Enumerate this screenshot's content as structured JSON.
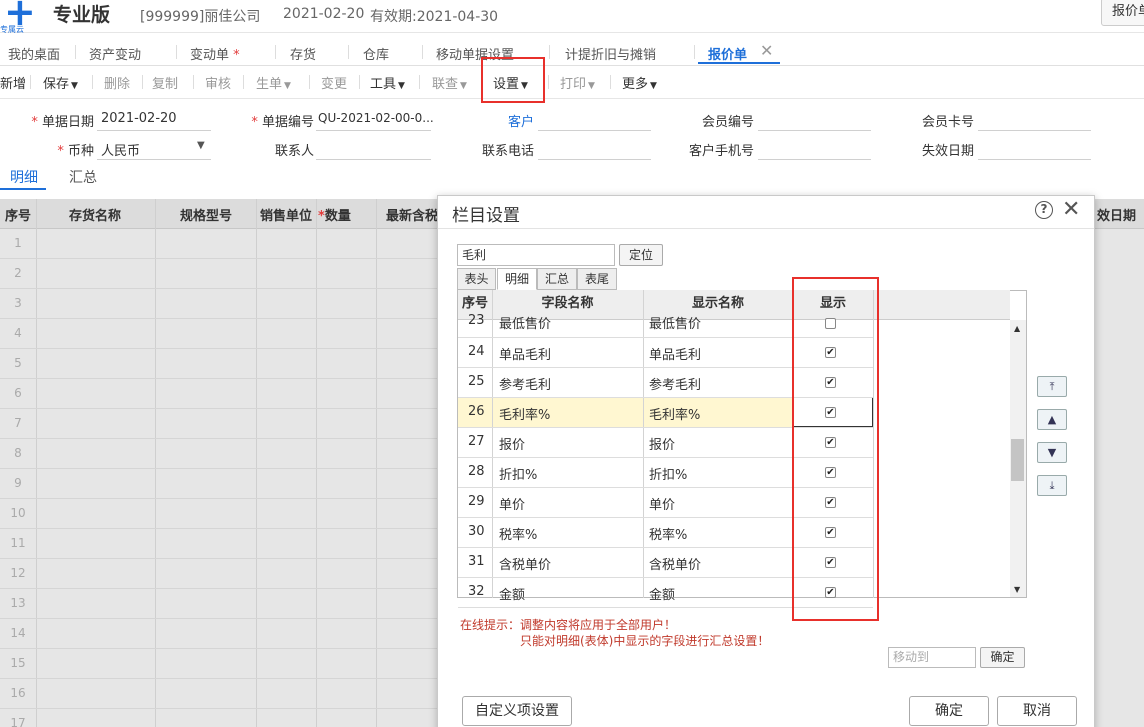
{
  "header": {
    "logo_sub": "专属云",
    "edition": "专业版",
    "company": "[999999]丽佳公司",
    "date": "2021-02-20",
    "validity": "有效期:2021-04-30",
    "quote_button": "报价单"
  },
  "nav_tabs": [
    {
      "label": "我的桌面"
    },
    {
      "label": "资产变动"
    },
    {
      "label": "变动单",
      "modified": "*"
    },
    {
      "label": "存货"
    },
    {
      "label": "仓库"
    },
    {
      "label": "移动单据设置"
    },
    {
      "label": "计提折旧与摊销"
    },
    {
      "label": "报价单",
      "active": true
    }
  ],
  "toolbar": {
    "new": "新增",
    "save": "保存",
    "delete": "删除",
    "copy": "复制",
    "audit": "审核",
    "generate": "生单",
    "change": "变更",
    "tools": "工具",
    "query": "联查",
    "settings": "设置",
    "print": "打印",
    "more": "更多"
  },
  "form": {
    "doc_date_label": "单据日期",
    "doc_date_value": "2021-02-20",
    "doc_no_label": "单据编号",
    "doc_no_value": "QU-2021-02-00-0...",
    "customer_label": "客户",
    "member_no_label": "会员编号",
    "member_card_label": "会员卡号",
    "currency_label": "币种",
    "currency_value": "人民币",
    "contact_label": "联系人",
    "phone_label": "联系电话",
    "mobile_label": "客户手机号",
    "expire_label": "失效日期"
  },
  "sub_tabs": {
    "detail": "明细",
    "summary": "汇总"
  },
  "grid": {
    "headers": [
      "序号",
      "存货名称",
      "规格型号",
      "销售单位",
      "数量",
      "最新含税",
      "效日期"
    ],
    "quantity_required": "*",
    "row_numbers": [
      "1",
      "2",
      "3",
      "4",
      "5",
      "6",
      "7",
      "8",
      "9",
      "10",
      "11",
      "12",
      "13",
      "14",
      "15",
      "16",
      "17"
    ]
  },
  "dialog": {
    "title": "栏目设置",
    "help": "?",
    "close": "✕",
    "search_value": "毛利",
    "locate_button": "定位",
    "tabs": [
      "表头",
      "明细",
      "汇总",
      "表尾"
    ],
    "active_tab": "明细",
    "columns": {
      "seq": "序号",
      "field": "字段名称",
      "display": "显示名称",
      "show": "显示"
    },
    "rows": [
      {
        "seq": "23",
        "field": "最低售价",
        "display": "最低售价",
        "checked": false
      },
      {
        "seq": "24",
        "field": "单品毛利",
        "display": "单品毛利",
        "checked": true
      },
      {
        "seq": "25",
        "field": "参考毛利",
        "display": "参考毛利",
        "checked": true
      },
      {
        "seq": "26",
        "field": "毛利率%",
        "display": "毛利率%",
        "checked": true,
        "selected": true
      },
      {
        "seq": "27",
        "field": "报价",
        "display": "报价",
        "checked": true
      },
      {
        "seq": "28",
        "field": "折扣%",
        "display": "折扣%",
        "checked": true
      },
      {
        "seq": "29",
        "field": "单价",
        "display": "单价",
        "checked": true
      },
      {
        "seq": "30",
        "field": "税率%",
        "display": "税率%",
        "checked": true
      },
      {
        "seq": "31",
        "field": "含税单价",
        "display": "含税单价",
        "checked": true
      },
      {
        "seq": "32",
        "field": "金额",
        "display": "金额",
        "checked": true
      }
    ],
    "tip_line1": "在线提示：调整内容将应用于全部用户！",
    "tip_line2": "只能对明细(表体)中显示的字段进行汇总设置！",
    "move_to_placeholder": "移动到",
    "move_confirm": "确定",
    "custom_button": "自定义项设置",
    "confirm_button": "确定",
    "cancel_button": "取消"
  },
  "colors": {
    "accent": "#1e6fd9",
    "highlight": "#e8302b",
    "selected_row": "#fff7d1"
  }
}
